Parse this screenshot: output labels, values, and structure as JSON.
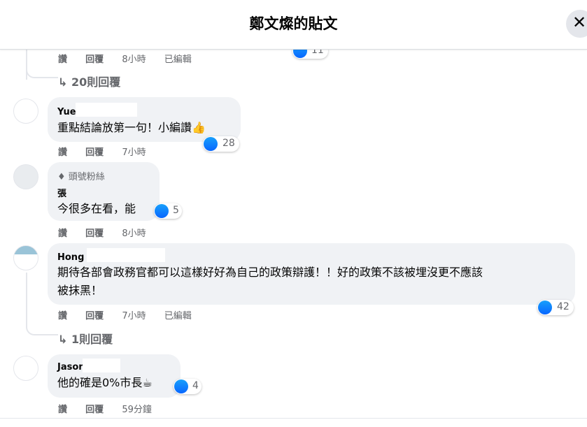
{
  "header": {
    "title": "鄭文燦的貼文",
    "close_symbol": "✕"
  },
  "actions": {
    "like": "讚",
    "reply": "回覆",
    "edited": "已編輯"
  },
  "prev_comment": {
    "time": "8小時",
    "reactions": "11",
    "replies": "20則回覆"
  },
  "comments": [
    {
      "name": "Yue",
      "text": "重點結論放第一句！小編讚👍",
      "time": "7小時",
      "reactions": "28"
    },
    {
      "badge": "頭號粉絲",
      "name": "張",
      "text": "今很多在看，能",
      "time": "8小時",
      "reactions": "5"
    },
    {
      "name": "Hong",
      "text_line1": "期待各部會政務官都可以這樣好好為自己的政策辯護！！好的政策不該被埋沒更不應該",
      "text_line2": "被抹黑！",
      "time": "7小時",
      "reactions": "42",
      "replies": "1則回覆"
    },
    {
      "name": "Jason",
      "text": "他的確是0%市長☕",
      "time": "59分鐘",
      "reactions": "4"
    }
  ],
  "colors": {
    "like_blue": "#0866ff",
    "bubble": "#f0f2f5",
    "meta": "#65676b"
  }
}
